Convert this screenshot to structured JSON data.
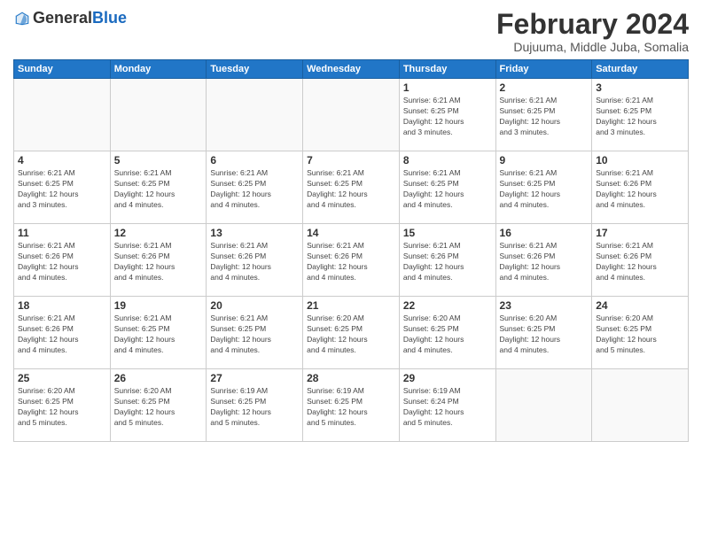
{
  "header": {
    "logo": {
      "general": "General",
      "blue": "Blue"
    },
    "title": "February 2024",
    "location": "Dujuuma, Middle Juba, Somalia"
  },
  "calendar": {
    "headers": [
      "Sunday",
      "Monday",
      "Tuesday",
      "Wednesday",
      "Thursday",
      "Friday",
      "Saturday"
    ],
    "weeks": [
      [
        {
          "day": "",
          "info": ""
        },
        {
          "day": "",
          "info": ""
        },
        {
          "day": "",
          "info": ""
        },
        {
          "day": "",
          "info": ""
        },
        {
          "day": "1",
          "info": "Sunrise: 6:21 AM\nSunset: 6:25 PM\nDaylight: 12 hours\nand 3 minutes."
        },
        {
          "day": "2",
          "info": "Sunrise: 6:21 AM\nSunset: 6:25 PM\nDaylight: 12 hours\nand 3 minutes."
        },
        {
          "day": "3",
          "info": "Sunrise: 6:21 AM\nSunset: 6:25 PM\nDaylight: 12 hours\nand 3 minutes."
        }
      ],
      [
        {
          "day": "4",
          "info": "Sunrise: 6:21 AM\nSunset: 6:25 PM\nDaylight: 12 hours\nand 3 minutes."
        },
        {
          "day": "5",
          "info": "Sunrise: 6:21 AM\nSunset: 6:25 PM\nDaylight: 12 hours\nand 4 minutes."
        },
        {
          "day": "6",
          "info": "Sunrise: 6:21 AM\nSunset: 6:25 PM\nDaylight: 12 hours\nand 4 minutes."
        },
        {
          "day": "7",
          "info": "Sunrise: 6:21 AM\nSunset: 6:25 PM\nDaylight: 12 hours\nand 4 minutes."
        },
        {
          "day": "8",
          "info": "Sunrise: 6:21 AM\nSunset: 6:25 PM\nDaylight: 12 hours\nand 4 minutes."
        },
        {
          "day": "9",
          "info": "Sunrise: 6:21 AM\nSunset: 6:25 PM\nDaylight: 12 hours\nand 4 minutes."
        },
        {
          "day": "10",
          "info": "Sunrise: 6:21 AM\nSunset: 6:26 PM\nDaylight: 12 hours\nand 4 minutes."
        }
      ],
      [
        {
          "day": "11",
          "info": "Sunrise: 6:21 AM\nSunset: 6:26 PM\nDaylight: 12 hours\nand 4 minutes."
        },
        {
          "day": "12",
          "info": "Sunrise: 6:21 AM\nSunset: 6:26 PM\nDaylight: 12 hours\nand 4 minutes."
        },
        {
          "day": "13",
          "info": "Sunrise: 6:21 AM\nSunset: 6:26 PM\nDaylight: 12 hours\nand 4 minutes."
        },
        {
          "day": "14",
          "info": "Sunrise: 6:21 AM\nSunset: 6:26 PM\nDaylight: 12 hours\nand 4 minutes."
        },
        {
          "day": "15",
          "info": "Sunrise: 6:21 AM\nSunset: 6:26 PM\nDaylight: 12 hours\nand 4 minutes."
        },
        {
          "day": "16",
          "info": "Sunrise: 6:21 AM\nSunset: 6:26 PM\nDaylight: 12 hours\nand 4 minutes."
        },
        {
          "day": "17",
          "info": "Sunrise: 6:21 AM\nSunset: 6:26 PM\nDaylight: 12 hours\nand 4 minutes."
        }
      ],
      [
        {
          "day": "18",
          "info": "Sunrise: 6:21 AM\nSunset: 6:26 PM\nDaylight: 12 hours\nand 4 minutes."
        },
        {
          "day": "19",
          "info": "Sunrise: 6:21 AM\nSunset: 6:25 PM\nDaylight: 12 hours\nand 4 minutes."
        },
        {
          "day": "20",
          "info": "Sunrise: 6:21 AM\nSunset: 6:25 PM\nDaylight: 12 hours\nand 4 minutes."
        },
        {
          "day": "21",
          "info": "Sunrise: 6:20 AM\nSunset: 6:25 PM\nDaylight: 12 hours\nand 4 minutes."
        },
        {
          "day": "22",
          "info": "Sunrise: 6:20 AM\nSunset: 6:25 PM\nDaylight: 12 hours\nand 4 minutes."
        },
        {
          "day": "23",
          "info": "Sunrise: 6:20 AM\nSunset: 6:25 PM\nDaylight: 12 hours\nand 4 minutes."
        },
        {
          "day": "24",
          "info": "Sunrise: 6:20 AM\nSunset: 6:25 PM\nDaylight: 12 hours\nand 5 minutes."
        }
      ],
      [
        {
          "day": "25",
          "info": "Sunrise: 6:20 AM\nSunset: 6:25 PM\nDaylight: 12 hours\nand 5 minutes."
        },
        {
          "day": "26",
          "info": "Sunrise: 6:20 AM\nSunset: 6:25 PM\nDaylight: 12 hours\nand 5 minutes."
        },
        {
          "day": "27",
          "info": "Sunrise: 6:19 AM\nSunset: 6:25 PM\nDaylight: 12 hours\nand 5 minutes."
        },
        {
          "day": "28",
          "info": "Sunrise: 6:19 AM\nSunset: 6:25 PM\nDaylight: 12 hours\nand 5 minutes."
        },
        {
          "day": "29",
          "info": "Sunrise: 6:19 AM\nSunset: 6:24 PM\nDaylight: 12 hours\nand 5 minutes."
        },
        {
          "day": "",
          "info": ""
        },
        {
          "day": "",
          "info": ""
        }
      ]
    ]
  }
}
